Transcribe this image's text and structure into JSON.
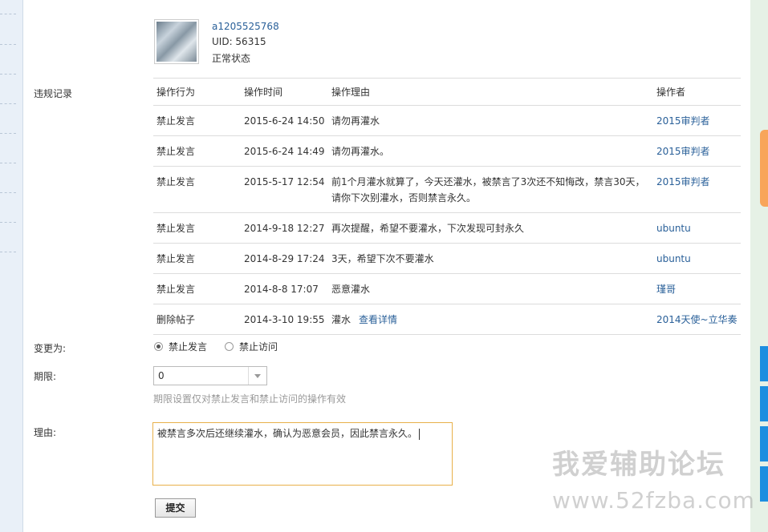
{
  "user": {
    "username": "a1205525768",
    "uid": "UID: 56315",
    "status": "正常状态"
  },
  "records": {
    "label": "违规记录",
    "headers": [
      "操作行为",
      "操作时间",
      "操作理由",
      "操作者"
    ],
    "rows": [
      {
        "action": "禁止发言",
        "time": "2015-6-24 14:50",
        "reason": "请勿再灌水",
        "operator": "2015审判者"
      },
      {
        "action": "禁止发言",
        "time": "2015-6-24 14:49",
        "reason": "请勿再灌水。",
        "operator": "2015审判者"
      },
      {
        "action": "禁止发言",
        "time": "2015-5-17 12:54",
        "reason": "前1个月灌水就算了，今天还灌水，被禁言了3次还不知悔改，禁言30天，请你下次别灌水，否则禁言永久。",
        "operator": "2015审判者"
      },
      {
        "action": "禁止发言",
        "time": "2014-9-18 12:27",
        "reason": "再次提醒，希望不要灌水，下次发现可封永久",
        "operator": "ubuntu"
      },
      {
        "action": "禁止发言",
        "time": "2014-8-29 17:24",
        "reason": "3天，希望下次不要灌水",
        "operator": "ubuntu"
      },
      {
        "action": "禁止发言",
        "time": "2014-8-8 17:07",
        "reason": "恶意灌水",
        "operator": "瑾哥"
      },
      {
        "action": "删除帖子",
        "time": "2014-3-10 19:55",
        "reason": "灌水",
        "detail_link": "查看详情",
        "operator": "2014天使~立华奏"
      }
    ]
  },
  "change_to": {
    "label": "变更为:",
    "options": [
      "禁止发言",
      "禁止访问"
    ],
    "selected": "禁止发言"
  },
  "period": {
    "label": "期限:",
    "value": "0",
    "hint": "期限设置仅对禁止发言和禁止访问的操作有效"
  },
  "reason": {
    "label": "理由:",
    "value": "被禁言多次后还继续灌水，确认为恶意会员，因此禁言永久。"
  },
  "submit_label": "提交",
  "watermark": {
    "title": "我爱辅助论坛",
    "url": "www.52fzba.com"
  },
  "colors": {
    "link": "#2a6099",
    "textarea_border": "#e8b04a",
    "side_orange": "#f8a55a",
    "side_blue": "#1d8ee0"
  }
}
